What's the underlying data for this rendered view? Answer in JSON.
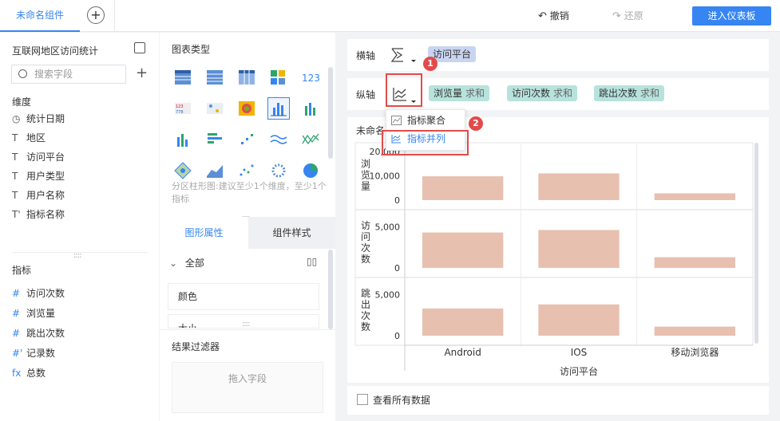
{
  "topbar": {
    "tab_label": "未命名组件",
    "add_tab_symbol": "+",
    "undo_label": "撤销",
    "redo_label": "还原",
    "enter_dashboard_label": "进入仪表板"
  },
  "data_panel": {
    "title": "互联网地区访问统计",
    "search_placeholder": "搜索字段",
    "dimensions_label": "维度",
    "dimensions": [
      {
        "icon": "clock-icon",
        "glyph": "◷",
        "label": "统计日期"
      },
      {
        "icon": "text-field-icon",
        "glyph": "T",
        "label": "地区"
      },
      {
        "icon": "text-field-icon",
        "glyph": "T",
        "label": "访问平台"
      },
      {
        "icon": "text-field-icon",
        "glyph": "T",
        "label": "用户类型"
      },
      {
        "icon": "text-field-icon",
        "glyph": "T",
        "label": "用户名称"
      },
      {
        "icon": "text-field-plus-icon",
        "glyph": "T'",
        "label": "指标名称"
      }
    ],
    "measures_label": "指标",
    "measures": [
      {
        "icon": "number-icon",
        "glyph": "#",
        "label": "访问次数"
      },
      {
        "icon": "number-icon",
        "glyph": "#",
        "label": "浏览量"
      },
      {
        "icon": "number-icon",
        "glyph": "#",
        "label": "跳出次数"
      },
      {
        "icon": "number-plus-icon",
        "glyph": "#'",
        "label": "记录数"
      },
      {
        "icon": "formula-icon",
        "glyph": "fx",
        "label": "总数"
      }
    ]
  },
  "chart_type_panel": {
    "title": "图表类型",
    "hint": "分区柱形图:建议至少1个维度，至少1个指标",
    "tab_properties": "图形属性",
    "tab_style": "组件样式",
    "all_label": "全部",
    "color_label": "颜色",
    "size_label": "大小",
    "filter_title": "结果过滤器",
    "filter_drop": "拖入字段"
  },
  "axes": {
    "x_label": "横轴",
    "x_field": "访问平台",
    "y_label": "纵轴",
    "y_fields": [
      {
        "name": "浏览量",
        "agg": "求和"
      },
      {
        "name": "访问次数",
        "agg": "求和"
      },
      {
        "name": "跳出次数",
        "agg": "求和"
      }
    ]
  },
  "dropdown": {
    "items": [
      "指标聚合",
      "指标并列"
    ],
    "selected": "指标并列"
  },
  "badges": [
    "1",
    "2"
  ],
  "chart_title": "未命名",
  "chart_data": {
    "type": "bar",
    "categories": [
      "Android",
      "IOS",
      "移动浏览器"
    ],
    "xlabel": "访问平台",
    "bar_color": "#e8c0b0",
    "panels": [
      {
        "ylabel": "浏览量",
        "ticks": [
          "20,000",
          "10,000",
          "0"
        ],
        "ylim": [
          0,
          20000
        ],
        "values": [
          9800,
          11000,
          2800
        ]
      },
      {
        "ylabel": "访问次数",
        "ticks": [
          "5,000",
          "0"
        ],
        "ylim": [
          0,
          6000
        ],
        "values": [
          4300,
          4600,
          1300
        ]
      },
      {
        "ylabel": "跳出次数",
        "ticks": [
          "5,000",
          "0"
        ],
        "ylim": [
          0,
          6000
        ],
        "values": [
          3300,
          3800,
          1100
        ]
      }
    ]
  },
  "show_all_label": "查看所有数据",
  "colors": {
    "accent": "#3685f2",
    "highlight": "#e34b4b"
  }
}
